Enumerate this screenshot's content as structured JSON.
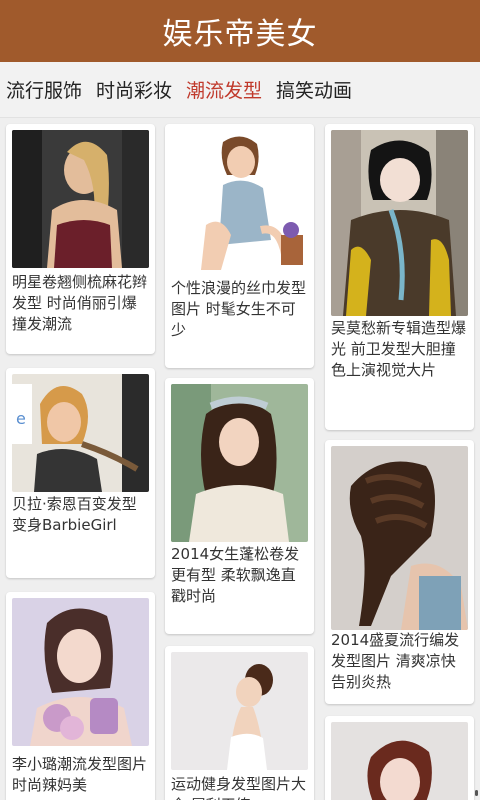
{
  "app": {
    "title": "娱乐帝美女"
  },
  "tabs": [
    {
      "label": "流行服饰",
      "active": false
    },
    {
      "label": "时尚彩妆",
      "active": false
    },
    {
      "label": "潮流发型",
      "active": true
    },
    {
      "label": "搞笑动画",
      "active": false
    }
  ],
  "colors": {
    "header": "#a05a2c",
    "active_tab": "#c0392b"
  },
  "items": [
    {
      "caption": "明星卷翘侧梳麻花辫发型 时尚俏丽引爆撞发潮流"
    },
    {
      "caption": "贝拉·索恩百变发型 变身BarbieGirl"
    },
    {
      "caption": "李小璐潮流发型图片 时尚辣妈美"
    },
    {
      "caption": "个性浪漫的丝巾发型图片 时髦女生不可少"
    },
    {
      "caption": "2014女生蓬松卷发更有型 柔软飘逸直戳时尚"
    },
    {
      "caption": "运动健身发型图片大全 犀利干练"
    },
    {
      "caption": "吴莫愁新专辑造型爆光 前卫发型大胆撞色上演视觉大片"
    },
    {
      "caption": "2014盛夏流行编发发型图片 清爽凉快告别炎热"
    },
    {
      "caption": ""
    }
  ]
}
